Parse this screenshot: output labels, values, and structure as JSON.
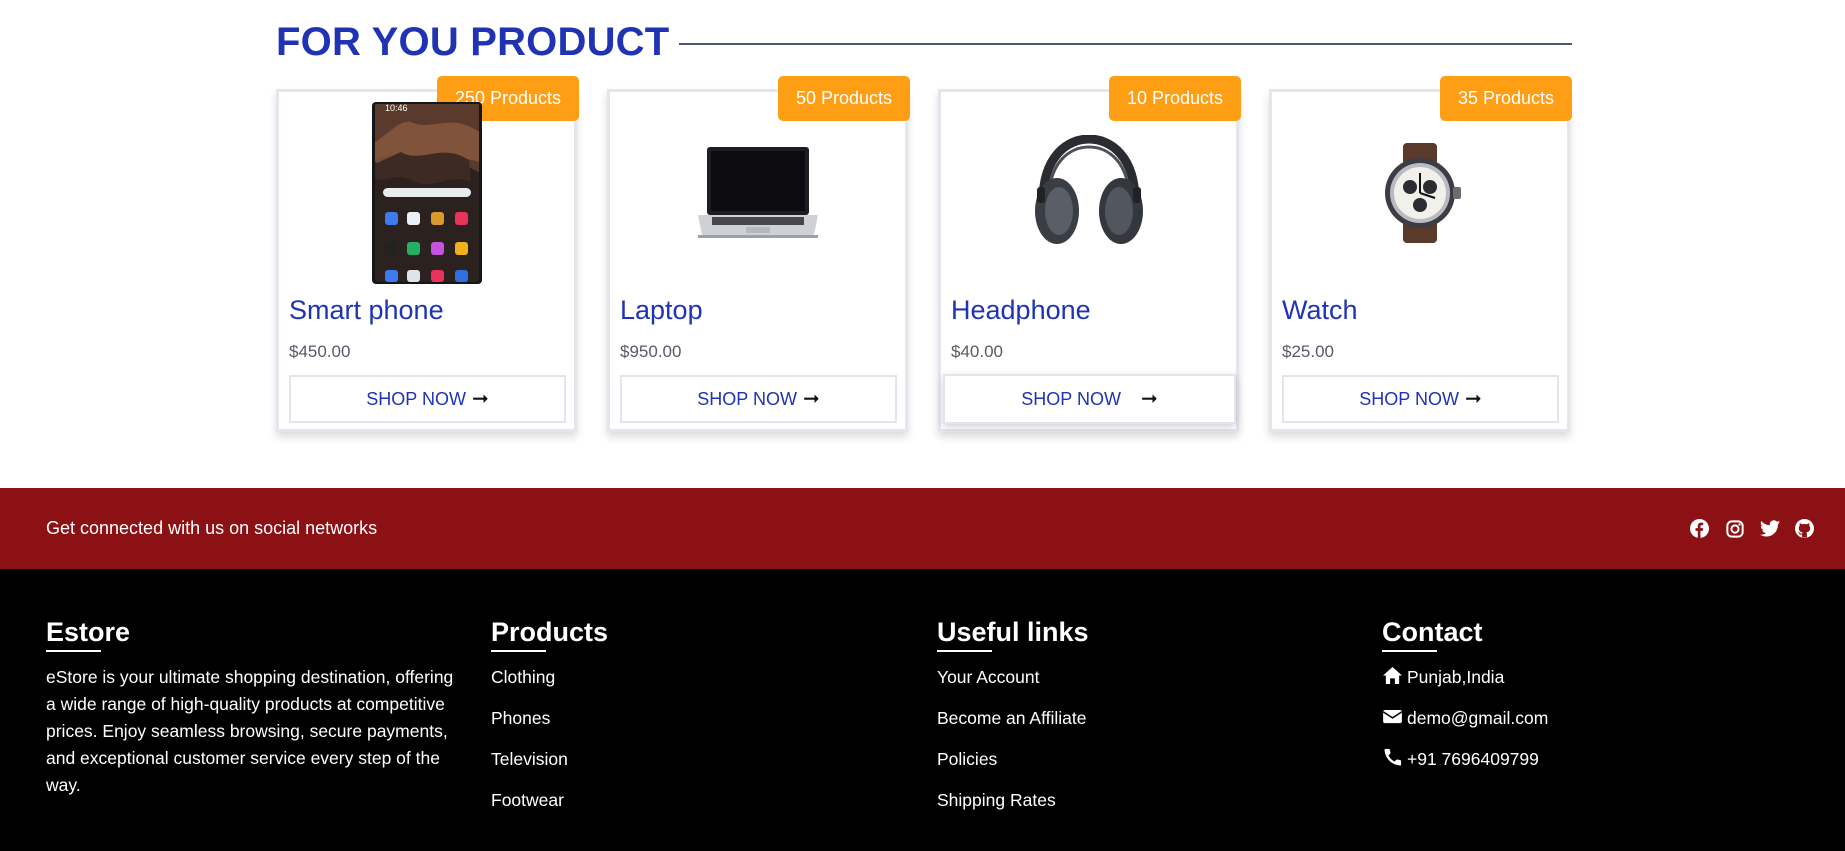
{
  "section": {
    "title": "FOR YOU PRODUCT"
  },
  "products": [
    {
      "badge": "250 Products",
      "name": "Smart phone",
      "price": "$450.00",
      "button": "SHOP NOW",
      "image_icon": "smartphone-image"
    },
    {
      "badge": "50 Products",
      "name": "Laptop",
      "price": "$950.00",
      "button": "SHOP NOW",
      "image_icon": "laptop-image"
    },
    {
      "badge": "10 Products",
      "name": "Headphone",
      "price": "$40.00",
      "button": "SHOP NOW",
      "image_icon": "headphone-image"
    },
    {
      "badge": "35 Products",
      "name": "Watch",
      "price": "$25.00",
      "button": "SHOP NOW",
      "image_icon": "watch-image"
    }
  ],
  "social": {
    "text": "Get connected with us on social networks",
    "icons": [
      "facebook-icon",
      "instagram-icon",
      "twitter-icon",
      "github-icon"
    ]
  },
  "footer": {
    "estore": {
      "heading": "Estore",
      "description": "eStore is your ultimate shopping destination, offering a wide range of high-quality products at competitive prices. Enjoy seamless browsing, secure payments, and exceptional customer service every step of the way."
    },
    "products": {
      "heading": "Products",
      "items": [
        "Clothing",
        "Phones",
        "Television",
        "Footwear"
      ]
    },
    "useful_links": {
      "heading": "Useful links",
      "items": [
        "Your Account",
        "Become an Affiliate",
        "Policies",
        "Shipping Rates"
      ]
    },
    "contact": {
      "heading": "Contact",
      "address": "Punjab,India",
      "email": "demo@gmail.com",
      "phone": "+91 7696409799"
    }
  },
  "colors": {
    "accent_blue": "#1f33b3",
    "badge_orange": "#fd9e15",
    "social_bar_red": "#8c1114",
    "footer_bg": "#000000"
  }
}
